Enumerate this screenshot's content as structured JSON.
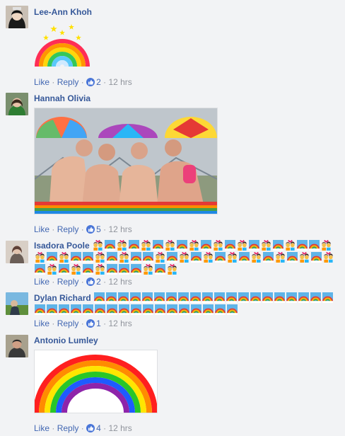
{
  "like_label": "Like",
  "reply_label": "Reply",
  "separator": "·",
  "comments": [
    {
      "author": "Lee-Ann Khoh",
      "likes": "2",
      "time": "12 hrs"
    },
    {
      "author": "Hannah Olivia",
      "likes": "5",
      "time": "12 hrs"
    },
    {
      "author": "Isadora Poole",
      "likes": "2",
      "time": "12 hrs"
    },
    {
      "author": "Dylan Richard",
      "likes": "1",
      "time": "12 hrs"
    },
    {
      "author": "Antonio Lumley",
      "likes": "4",
      "time": "12 hrs"
    }
  ],
  "icons": {
    "like": "thumbs-up-icon",
    "rainbow_emoji": "rainbow-emoji-icon",
    "couple_emoji": "couple-emoji-icon",
    "sticker": "rainbow-stars-sticker"
  },
  "colors": {
    "background": "#f2f3f5",
    "author_link": "#365899",
    "action_link": "#4267b2",
    "meta_text": "#90949c",
    "like_badge": "#4a76d8"
  }
}
